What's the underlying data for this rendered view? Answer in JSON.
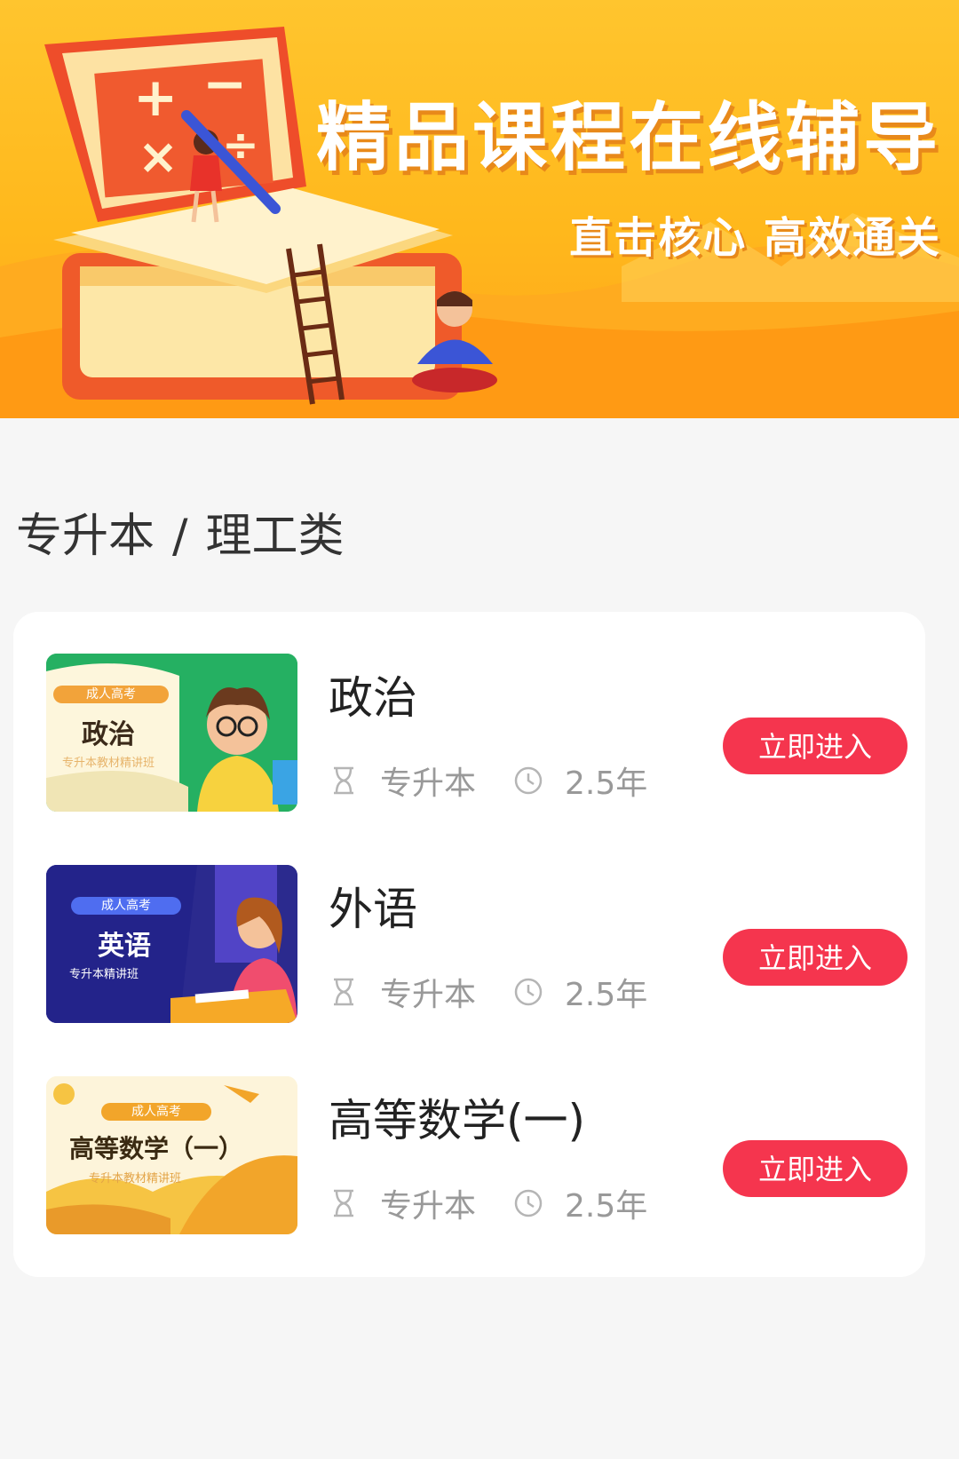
{
  "banner": {
    "title": "精品课程在线辅导",
    "subtitle": "直击核心 高效通关"
  },
  "breadcrumb": {
    "level1": "专升本",
    "separator": "/",
    "level2": "理工类"
  },
  "courses": [
    {
      "name": "政治",
      "thumb_tag": "成人高考",
      "thumb_title": "政治",
      "thumb_sub": "专升本教材精讲班",
      "level": "专升本",
      "duration": "2.5年",
      "button": "立即进入"
    },
    {
      "name": "外语",
      "thumb_tag": "成人高考",
      "thumb_title": "英语",
      "thumb_sub": "专升本精讲班",
      "level": "专升本",
      "duration": "2.5年",
      "button": "立即进入"
    },
    {
      "name": "高等数学(一)",
      "thumb_tag": "成人高考",
      "thumb_title": "高等数学（一）",
      "thumb_sub": "专升本教材精讲班",
      "level": "专升本",
      "duration": "2.5年",
      "button": "立即进入"
    }
  ],
  "colors": {
    "accent": "#f5354e",
    "banner": "#ffb81c",
    "background": "#f6f6f6"
  },
  "icons": {
    "level": "hourglass-icon",
    "duration": "clock-icon"
  }
}
